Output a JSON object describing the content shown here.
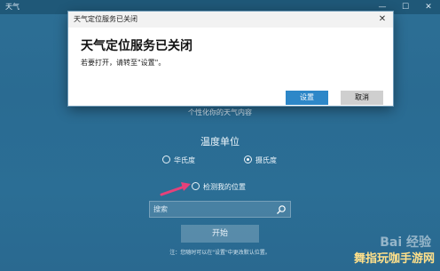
{
  "app": {
    "title": "天气",
    "controls": [
      "—",
      "☐",
      "✕"
    ]
  },
  "dialog": {
    "title_bar": "天气定位服务已关闭",
    "close": "✕",
    "heading": "天气定位服务已关闭",
    "body": "若要打开，请转至\"设置\"。",
    "settings_label": "设置",
    "cancel_label": "取消"
  },
  "main": {
    "personalize": "个性化你的天气内容",
    "temperature_unit_title": "温度单位",
    "fahrenheit_label": "华氏度",
    "celsius_label": "摄氏度",
    "detect_location_label": "检测我的位置",
    "search_placeholder": "搜索",
    "start_label": "开始",
    "note": "注：您随时可以在\"设置\"中更改默认位置。"
  },
  "watermark": "Bai 经验",
  "corner_logo": "舞指玩咖手游网",
  "colors": {
    "accent": "#2d87c8",
    "background": "#2b6e95",
    "arrow": "#e6417a"
  }
}
